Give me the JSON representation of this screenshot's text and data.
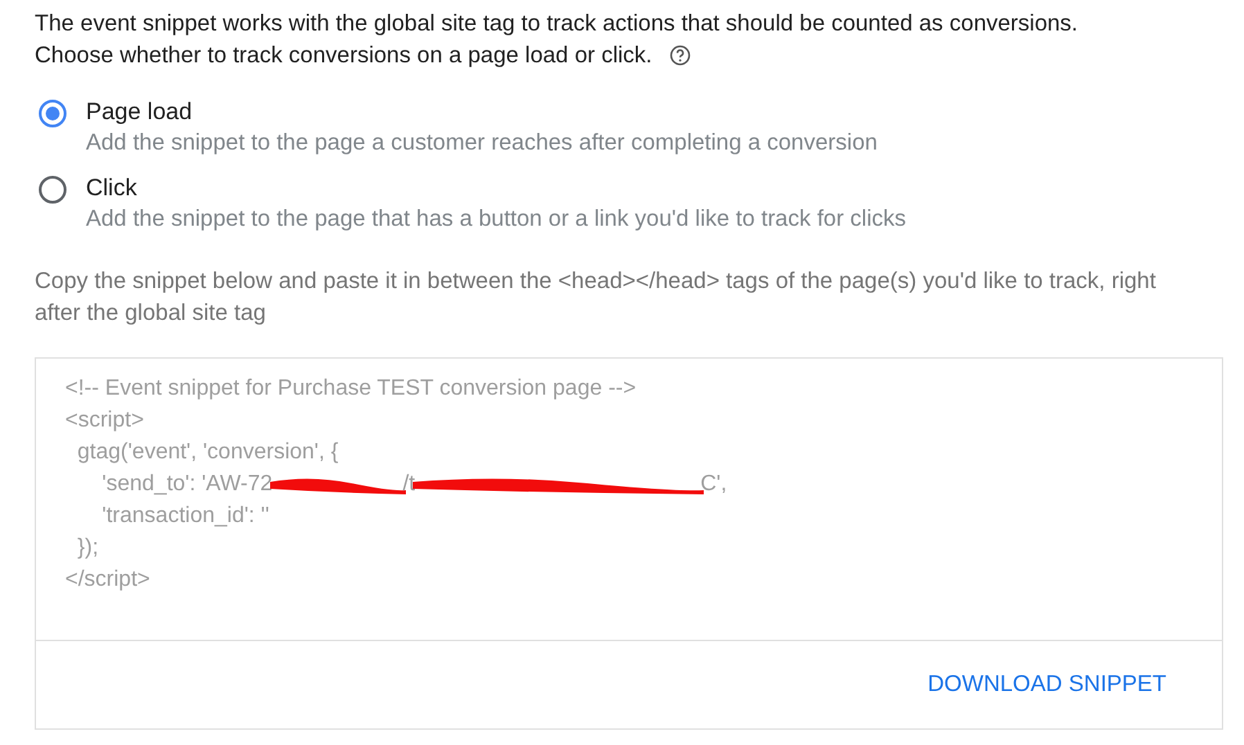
{
  "intro": "The event snippet works with the global site tag to track actions that should be counted as conversions. Choose whether to track conversions on a page load or click.",
  "options": [
    {
      "label": "Page load",
      "description": "Add the snippet to the page a customer reaches after completing a conversion",
      "selected": true
    },
    {
      "label": "Click",
      "description": "Add the snippet to the page that has a button or a link you'd like to track for clicks",
      "selected": false
    }
  ],
  "instructions": "Copy the snippet below and paste it in between the <head></head> tags of the page(s) you'd like to track, right after the global site tag",
  "snippet": {
    "lines": [
      {
        "parts": [
          {
            "kind": "text",
            "text": "<!-- Event snippet for Purchase TEST conversion page -->"
          }
        ]
      },
      {
        "parts": [
          {
            "kind": "text",
            "text": "<script>"
          }
        ]
      },
      {
        "parts": [
          {
            "kind": "text",
            "text": "  gtag('event', 'conversion', {"
          }
        ]
      },
      {
        "parts": [
          {
            "kind": "text",
            "text": "      'send_to': 'AW-72"
          },
          {
            "kind": "redacted"
          },
          {
            "kind": "text",
            "text": "/t"
          },
          {
            "kind": "redacted"
          },
          {
            "kind": "text",
            "text": "C',"
          }
        ]
      },
      {
        "parts": [
          {
            "kind": "text",
            "text": "      'transaction_id': ''"
          }
        ]
      },
      {
        "parts": [
          {
            "kind": "text",
            "text": "  });"
          }
        ]
      },
      {
        "parts": [
          {
            "kind": "text",
            "text": "</script>"
          }
        ]
      }
    ]
  },
  "download_button": "DOWNLOAD SNIPPET"
}
